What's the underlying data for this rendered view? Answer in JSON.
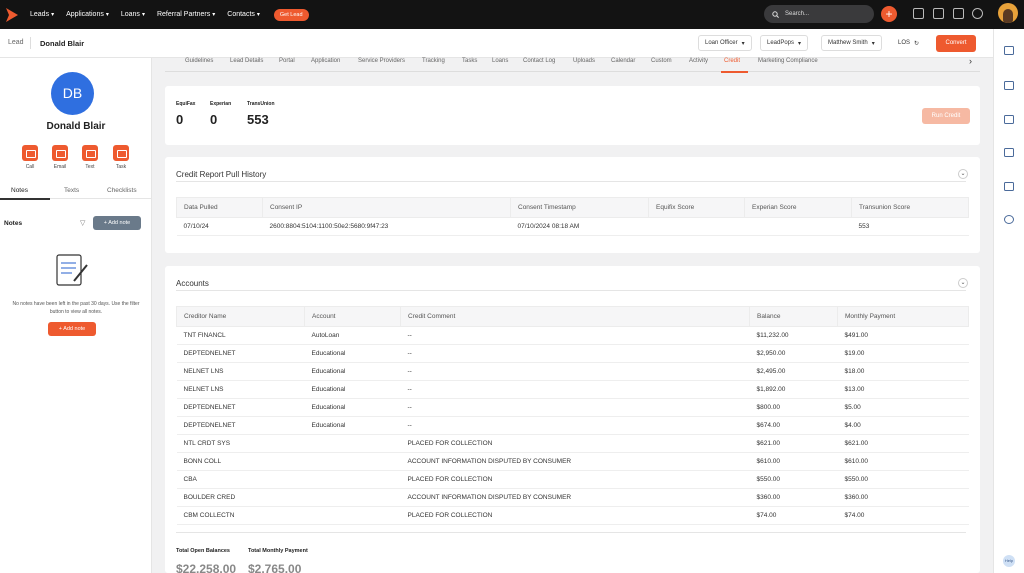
{
  "topnav": {
    "items": [
      {
        "label": "Leads"
      },
      {
        "label": "Applications"
      },
      {
        "label": "Loans"
      },
      {
        "label": "Referral Partners"
      },
      {
        "label": "Contacts"
      }
    ],
    "get_lead": "Get Lead",
    "search_placeholder": "Search...",
    "accent": "#ee5a2f"
  },
  "header": {
    "crumb": "Lead",
    "name": "Donald Blair",
    "selects": [
      "Loan Officer",
      "LeadPops",
      "Matthew Smith",
      "LOS"
    ],
    "convert": "Convert"
  },
  "profile": {
    "initials": "DB",
    "name": "Donald Blair",
    "actions": [
      "Call",
      "Email",
      "Text",
      "Task"
    ],
    "tabs": [
      "Notes",
      "Texts",
      "Checklists"
    ],
    "notes_title": "Notes",
    "add_note": "Add note",
    "empty_text": "No notes have been left in the past 30 days. Use the filter button to view all notes.",
    "add_note_bottom": "Add note"
  },
  "tabs": [
    "Guidelines",
    "Lead Details",
    "Portal",
    "Application",
    "Service Providers",
    "Tracking",
    "Tasks",
    "Loans",
    "Contact Log",
    "Uploads",
    "Calendar",
    "Custom",
    "Activity",
    "Credit",
    "Marketing Compliance"
  ],
  "scores": {
    "equifax_label": "EquiFax",
    "equifax": "0",
    "experian_label": "Experian",
    "experian": "0",
    "transunion_label": "TransUnion",
    "transunion": "553",
    "run_credit": "Run Credit"
  },
  "history": {
    "title": "Credit Report Pull History",
    "headers": [
      "Data Pulled",
      "Consent IP",
      "Consent Timestamp",
      "Equifix Score",
      "Experian Score",
      "Transunion Score"
    ],
    "rows": [
      [
        "07/10/24",
        "2600:8804:5104:1100:50e2:5680:9f47:23",
        "07/10/2024 08:18 AM",
        "",
        "",
        "553"
      ]
    ]
  },
  "accounts": {
    "title": "Accounts",
    "headers": [
      "Creditor Name",
      "Account",
      "Credit Comment",
      "Balance",
      "Monthly Payment"
    ],
    "rows": [
      [
        "TNT FINANCL",
        "AutoLoan",
        "--",
        "$11,232.00",
        "$491.00"
      ],
      [
        "DEPTEDNELNET",
        "Educational",
        "--",
        "$2,950.00",
        "$19.00"
      ],
      [
        "NELNET LNS",
        "Educational",
        "--",
        "$2,495.00",
        "$18.00"
      ],
      [
        "NELNET LNS",
        "Educational",
        "--",
        "$1,892.00",
        "$13.00"
      ],
      [
        "DEPTEDNELNET",
        "Educational",
        "--",
        "$800.00",
        "$5.00"
      ],
      [
        "DEPTEDNELNET",
        "Educational",
        "--",
        "$674.00",
        "$4.00"
      ],
      [
        "NTL CRDT SYS",
        "",
        "PLACED FOR COLLECTION",
        "$621.00",
        "$621.00"
      ],
      [
        "BONN COLL",
        "",
        "ACCOUNT INFORMATION DISPUTED BY CONSUMER",
        "$610.00",
        "$610.00"
      ],
      [
        "CBA",
        "",
        "PLACED FOR COLLECTION",
        "$550.00",
        "$550.00"
      ],
      [
        "BOULDER CRED",
        "",
        "ACCOUNT INFORMATION DISPUTED BY CONSUMER",
        "$360.00",
        "$360.00"
      ],
      [
        "CBM COLLECTN",
        "",
        "PLACED FOR COLLECTION",
        "$74.00",
        "$74.00"
      ]
    ],
    "total_open_label": "Total Open Balances",
    "total_open": "$22,258.00",
    "total_monthly_label": "Total Monthly Payment",
    "total_monthly": "$2,765.00"
  },
  "rail": {
    "help": "Help"
  }
}
